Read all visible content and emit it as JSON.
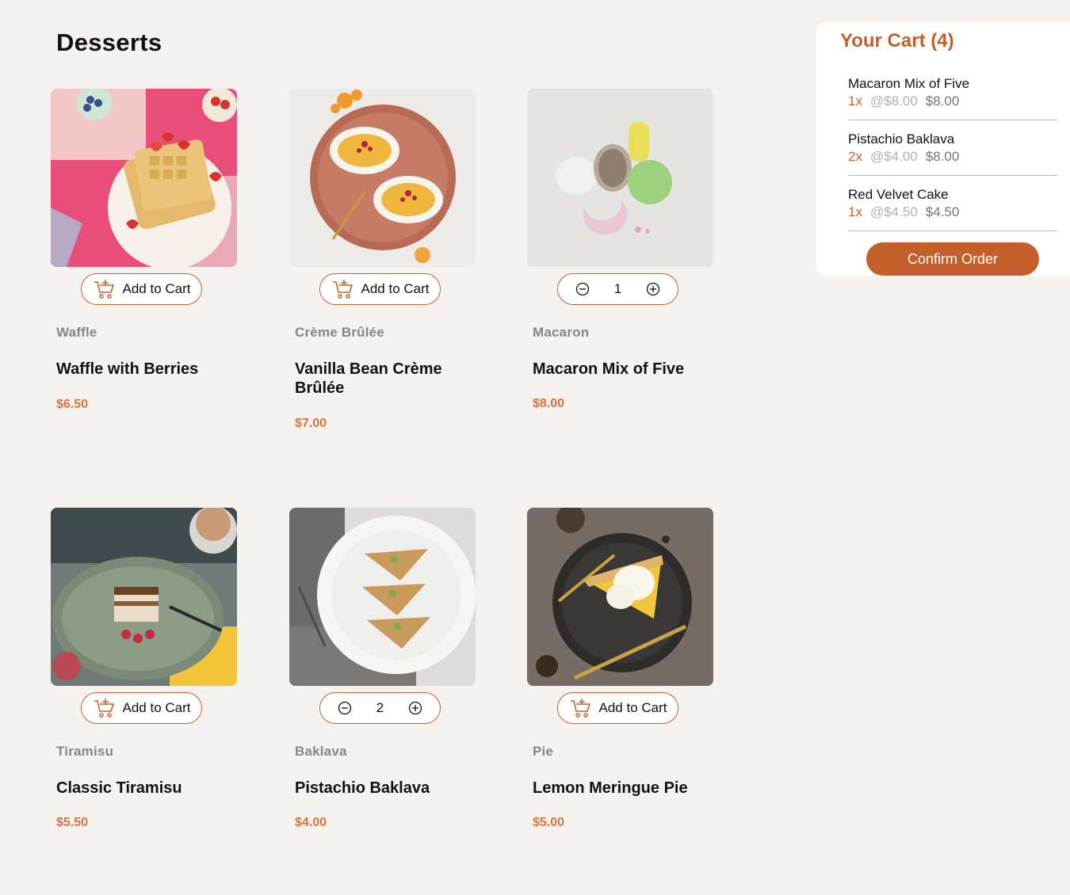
{
  "page": {
    "title": "Desserts"
  },
  "products": [
    {
      "category": "Waffle",
      "name": "Waffle with Berries",
      "price": "$6.50",
      "in_cart": false,
      "add_label": "Add to Cart"
    },
    {
      "category": "Crème Brûlée",
      "name": "Vanilla Bean Crème Brûlée",
      "price": "$7.00",
      "in_cart": false,
      "add_label": "Add to Cart"
    },
    {
      "category": "Macaron",
      "name": "Macaron Mix of Five",
      "price": "$8.00",
      "in_cart": true,
      "quantity": "1",
      "add_label": ""
    },
    {
      "category": "Tiramisu",
      "name": "Classic Tiramisu",
      "price": "$5.50",
      "in_cart": false,
      "add_label": "Add to Cart"
    },
    {
      "category": "Baklava",
      "name": "Pistachio Baklava",
      "price": "$4.00",
      "in_cart": true,
      "quantity": "2",
      "add_label": ""
    },
    {
      "category": "Pie",
      "name": "Lemon Meringue Pie",
      "price": "$5.00",
      "in_cart": false,
      "add_label": "Add to Cart"
    }
  ],
  "cart": {
    "title": "Your Cart (4)",
    "items": [
      {
        "name": "Macaron Mix of Five",
        "qty": "1x",
        "unit": "@$8.00",
        "total": "$8.00"
      },
      {
        "name": "Pistachio Baklava",
        "qty": "2x",
        "unit": "@$4.00",
        "total": "$8.00"
      },
      {
        "name": "Red Velvet Cake",
        "qty": "1x",
        "unit": "@$4.50",
        "total": "$4.50"
      }
    ],
    "confirm_label": "Confirm Order"
  },
  "colors": {
    "background": "#f6f2ef",
    "accent": "#c25f2a",
    "price": "#d6743d",
    "category": "#8a8582"
  },
  "icons": {
    "add_to_cart": "cart-plus-icon",
    "decrement": "minus-circle-icon",
    "increment": "plus-circle-icon"
  }
}
